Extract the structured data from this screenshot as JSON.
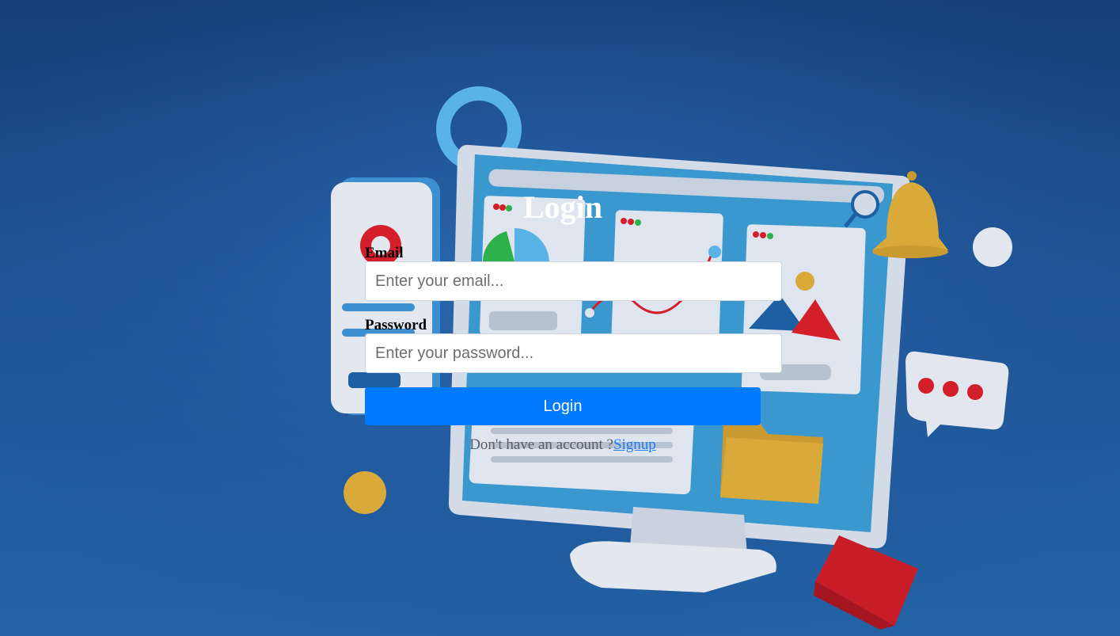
{
  "login": {
    "title": "Login",
    "email_label": "Email",
    "email_placeholder": "Enter your email...",
    "password_label": "Password",
    "password_placeholder": "Enter your password...",
    "submit_label": "Login",
    "signup_prompt": "Don't have an account ?",
    "signup_link": "Signup"
  },
  "colors": {
    "button": "#007bff",
    "link": "#1e7cf5",
    "background": "#1f5596"
  }
}
